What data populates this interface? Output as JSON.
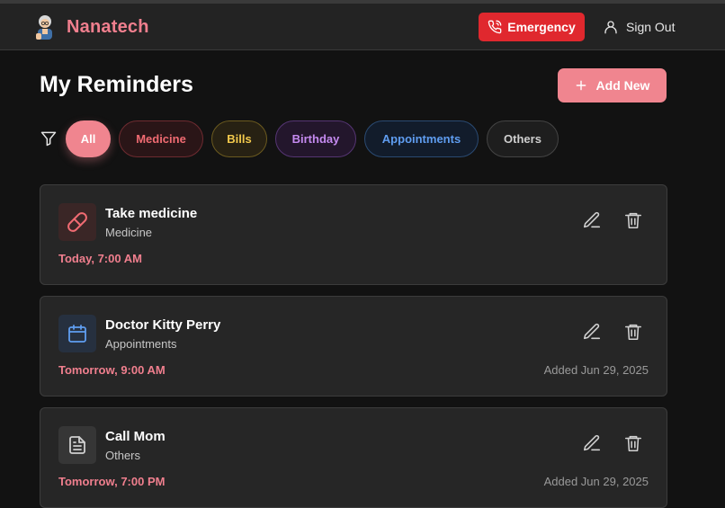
{
  "app": {
    "name": "Nanatech",
    "avatar_icon": "grandma-avatar-icon",
    "accent_color": "#f07f8e"
  },
  "header": {
    "emergency_label": "Emergency",
    "emergency_icon": "phone-call-icon",
    "signout_label": "Sign Out",
    "signout_icon": "user-icon"
  },
  "main": {
    "title": "My Reminders",
    "add_new_label": "Add New"
  },
  "filters": {
    "icon": "filter-icon",
    "chips": [
      {
        "label": "All",
        "active": true
      },
      {
        "label": "Medicine",
        "active": false
      },
      {
        "label": "Bills",
        "active": false
      },
      {
        "label": "Birthday",
        "active": false
      },
      {
        "label": "Appointments",
        "active": false
      },
      {
        "label": "Others",
        "active": false
      }
    ]
  },
  "reminders": [
    {
      "title": "Take medicine",
      "category": "Medicine",
      "time": "Today, 7:00 AM",
      "added": "",
      "icon": "pill-icon"
    },
    {
      "title": "Doctor Kitty Perry",
      "category": "Appointments",
      "time": "Tomorrow, 9:00 AM",
      "added": "Added Jun 29, 2025",
      "icon": "calendar-icon"
    },
    {
      "title": "Call Mom",
      "category": "Others",
      "time": "Tomorrow, 7:00 PM",
      "added": "Added Jun 29, 2025",
      "icon": "document-icon"
    }
  ]
}
